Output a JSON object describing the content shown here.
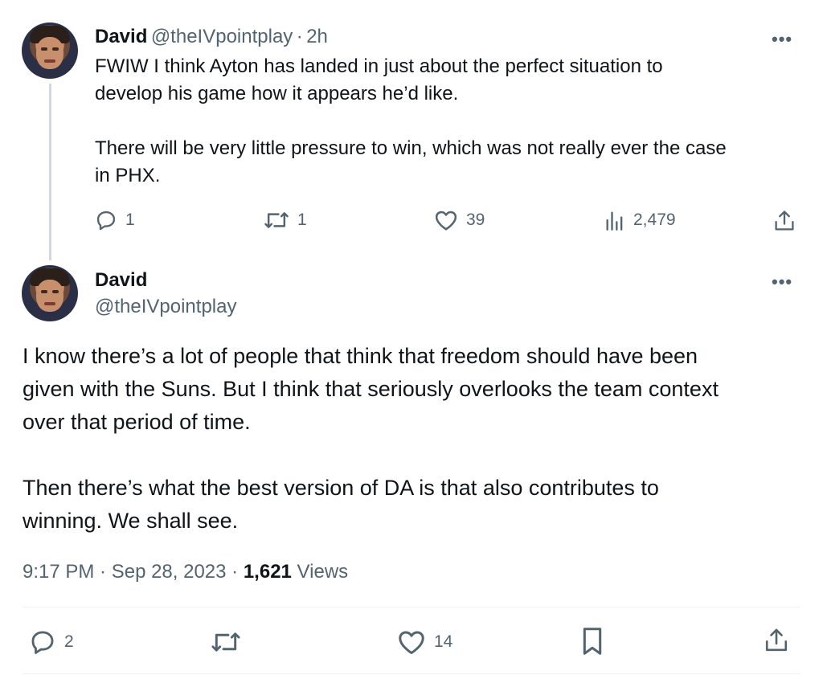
{
  "reply_tweet": {
    "author_name": "David",
    "author_handle": "@theIVpointplay",
    "separator": "·",
    "time": "2h",
    "more": "•••",
    "text": "FWIW I think Ayton has landed in just about the perfect situation to\ndevelop his game how it appears he’d like.\n\nThere will be very little pressure to win, which was not really ever the case\nin PHX.",
    "replies": "1",
    "retweets": "1",
    "likes": "39",
    "views": "2,479"
  },
  "main_tweet": {
    "author_name": "David",
    "author_handle": "@theIVpointplay",
    "more": "•••",
    "text": "I know there’s a lot of people that think that freedom should have been\ngiven with the Suns. But I think that seriously overlooks the team context\nover that period of time.\n\nThen there’s what the best version of DA is that also contributes to\nwinning. We shall see.",
    "timestamp": "9:17 PM · Sep 28, 2023 · ",
    "views_count": "1,621",
    "views_label": " Views",
    "replies": "2",
    "likes": "14"
  },
  "icons": [
    "reply-icon",
    "retweet-icon",
    "like-icon",
    "views-icon",
    "share-icon",
    "bookmark-icon",
    "more-icon"
  ],
  "colors": {
    "text": "#0f1419",
    "secondary": "#536471",
    "thread_line": "#cfd9de"
  }
}
